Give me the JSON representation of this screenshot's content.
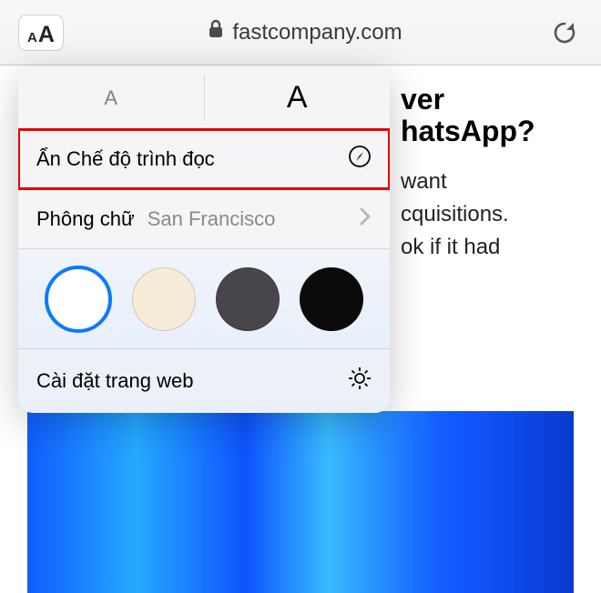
{
  "toolbar": {
    "aa_small": "A",
    "aa_large": "A",
    "domain": "fastcompany.com"
  },
  "article": {
    "title_fragment": "ver\nhatsApp?",
    "body_fragment": "want\ncquisitions.\nok if it had"
  },
  "popover": {
    "font_decrease": "A",
    "font_increase": "A",
    "hide_reader_label": "Ẩn Chế độ trình đọc",
    "font_label": "Phông chữ",
    "font_value": "San Francisco",
    "theme_colors": [
      {
        "hex": "#ffffff",
        "selected": true
      },
      {
        "hex": "#f7ecd7",
        "selected": false
      },
      {
        "hex": "#48464a",
        "selected": false
      },
      {
        "hex": "#0b0b0b",
        "selected": false
      }
    ],
    "website_settings_label": "Cài đặt trang web"
  }
}
